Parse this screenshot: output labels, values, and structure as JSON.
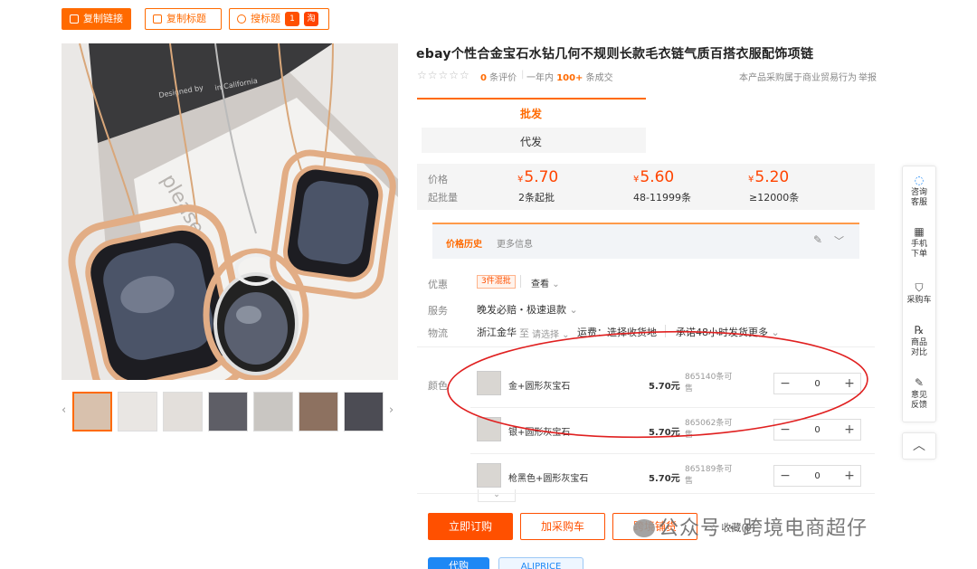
{
  "toolbar": {
    "copy_link": "复制链接",
    "copy_title": "复制标题",
    "search_title": "搜标题",
    "logo_a": "1",
    "logo_b": "淘"
  },
  "product": {
    "title": "ebay个性合金宝石水钻几何不规则长款毛衣链气质百搭衣服配饰项链",
    "stars": "☆☆☆☆☆",
    "review_count": "0",
    "review_label": "条评价",
    "period": "一年内",
    "sold": "100+",
    "sold_label": "条成交",
    "notice": "本产品采购属于商业贸易行为",
    "report": "举报"
  },
  "tabs": {
    "wholesale": "批发",
    "dropship": "代发"
  },
  "price_box": {
    "price_label": "价格",
    "moq_label": "起批量",
    "currency": "¥",
    "tiers": [
      {
        "price": "5.70",
        "qty": "2条起批"
      },
      {
        "price": "5.60",
        "qty": "48-11999条"
      },
      {
        "price": "5.20",
        "qty": "≥12000条"
      }
    ]
  },
  "history": {
    "tab_active": "价格历史",
    "tab_more": "更多信息"
  },
  "rows": {
    "promo_label": "优惠",
    "promo_badge": "3件混批",
    "promo_view": "查看",
    "service_label": "服务",
    "service_text": "晚发必赔・极速退款",
    "logistics_label": "物流",
    "origin": "浙江金华",
    "to": "至",
    "select": "请选择",
    "freight": "运费：选择收货地",
    "ship": "承诺48小时发货",
    "more": "更多",
    "color_label": "颜色"
  },
  "variants": [
    {
      "name": "金+圆形灰宝石",
      "price": "5.70元",
      "stock": "865140条可售",
      "qty": "0"
    },
    {
      "name": "银+圆形灰宝石",
      "price": "5.70元",
      "stock": "865062条可售",
      "qty": "0"
    },
    {
      "name": "枪黑色+圆形灰宝石",
      "price": "5.70元",
      "stock": "865189条可售",
      "qty": "0"
    }
  ],
  "stepper": {
    "minus": "−",
    "plus": "+"
  },
  "actions": {
    "buy_now": "立即订购",
    "add_cart": "加采购车",
    "cross_border": "跨境铺货",
    "favorite": "收藏(0)"
  },
  "bottom_tabs": {
    "dropship": "代购",
    "brand": "ALIPRICE"
  },
  "rail": {
    "items": [
      {
        "label1": "咨询",
        "label2": "客服",
        "icon": "chat-icon"
      },
      {
        "label1": "手机",
        "label2": "下单",
        "icon": "qr-icon"
      },
      {
        "label1": "采购车",
        "label2": "",
        "icon": "cart-icon"
      },
      {
        "label1": "商品",
        "label2": "对比",
        "icon": "compare-icon"
      },
      {
        "label1": "意见",
        "label2": "反馈",
        "icon": "feedback-icon"
      }
    ],
    "top": "︿"
  },
  "watermark": "公众号 · 跨境电商超仔",
  "image_text": {
    "line1": "Designed by",
    "line2": "in California",
    "card": "please"
  },
  "colors": {
    "accent": "#ff6a00",
    "price": "#ff4400",
    "highlight_circle": "#e02020"
  }
}
